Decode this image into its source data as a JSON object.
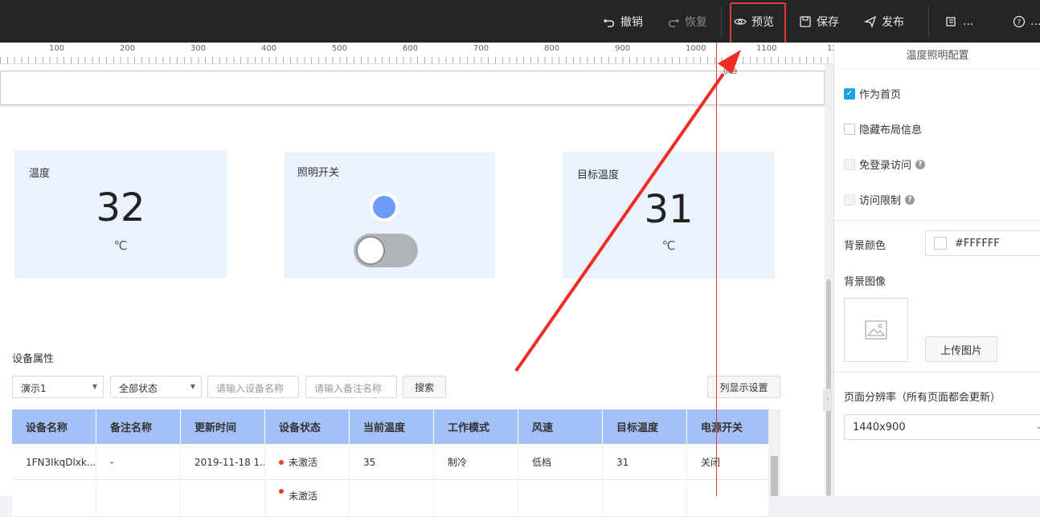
{
  "toolbar": {
    "undo_label": "撤销",
    "redo_label": "恢复",
    "preview_label": "预览",
    "save_label": "保存",
    "publish_label": "发布",
    "more1_label": "...",
    "more2_label": "..."
  },
  "ruler": {
    "labels": [
      "100",
      "200",
      "300",
      "400",
      "500",
      "600",
      "700",
      "800",
      "900",
      "1000",
      "1100",
      "12"
    ],
    "guide_value": "049"
  },
  "cards": [
    {
      "title": "温度",
      "value": "32",
      "unit": "℃"
    },
    {
      "title": "照明开关"
    },
    {
      "title": "目标温度",
      "value": "31",
      "unit": "℃"
    }
  ],
  "device_section": {
    "title": "设备属性",
    "filter_select_1": "演示1",
    "filter_select_2": "全部状态",
    "device_name_placeholder": "请输入设备名称",
    "remark_name_placeholder": "请输入备注名称",
    "search_label": "搜索",
    "column_settings_label": "列显示设置",
    "columns": [
      "设备名称",
      "备注名称",
      "更新时间",
      "设备状态",
      "当前温度",
      "工作模式",
      "风速",
      "目标温度",
      "电源开关"
    ],
    "rows": [
      [
        "1FN3IkqDlxk...",
        "-",
        "2019-11-18 1...",
        "未激活",
        "35",
        "制冷",
        "低档",
        "31",
        "关闭"
      ],
      [
        "",
        "",
        "",
        "未激活",
        "",
        "",
        "",
        "",
        ""
      ]
    ]
  },
  "panel": {
    "title": "温度照明配置",
    "checkbox_homepage": "作为首页",
    "checkbox_hide_layout": "隐藏布局信息",
    "checkbox_no_login": "免登录访问",
    "checkbox_access_limit": "访问限制",
    "bg_color_label": "背景颜色",
    "bg_color_value": "#FFFFFF",
    "bg_image_label": "背景图像",
    "upload_label": "上传图片",
    "resolution_label": "页面分辨率（所有页面都会更新）",
    "resolution_value": "1440x900"
  },
  "colors": {
    "accent": "#1ba3e8",
    "table_header": "#a3c1f7",
    "card_bg": "#eaf3fd",
    "annotation_red": "#e53935"
  }
}
